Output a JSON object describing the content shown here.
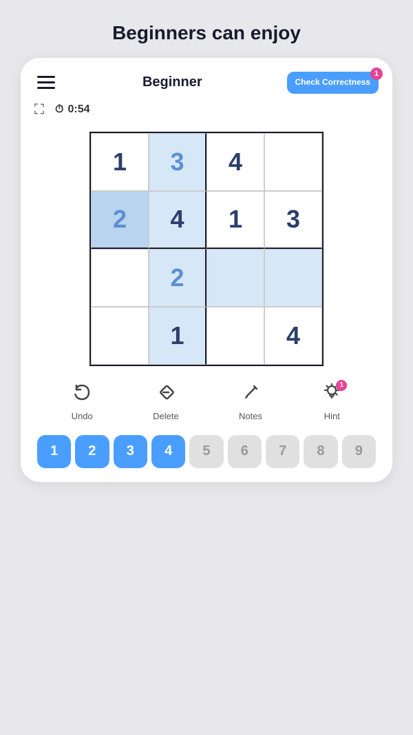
{
  "page": {
    "title": "Beginners can enjoy"
  },
  "header": {
    "title": "Beginner",
    "check_btn": "Check\nCorrectness",
    "badge": "1"
  },
  "timer": {
    "value": "0:54"
  },
  "grid": {
    "cells": [
      {
        "row": 1,
        "col": 1,
        "value": "1",
        "type": "given",
        "bg": "normal"
      },
      {
        "row": 1,
        "col": 2,
        "value": "3",
        "type": "filled",
        "bg": "highlight"
      },
      {
        "row": 1,
        "col": 3,
        "value": "4",
        "type": "given",
        "bg": "normal"
      },
      {
        "row": 1,
        "col": 4,
        "value": "",
        "type": "empty",
        "bg": "normal"
      },
      {
        "row": 2,
        "col": 1,
        "value": "2",
        "type": "filled",
        "bg": "highlight-dark"
      },
      {
        "row": 2,
        "col": 2,
        "value": "4",
        "type": "given",
        "bg": "highlight"
      },
      {
        "row": 2,
        "col": 3,
        "value": "1",
        "type": "given",
        "bg": "normal"
      },
      {
        "row": 2,
        "col": 4,
        "value": "3",
        "type": "given",
        "bg": "normal"
      },
      {
        "row": 3,
        "col": 1,
        "value": "",
        "type": "empty",
        "bg": "normal"
      },
      {
        "row": 3,
        "col": 2,
        "value": "2",
        "type": "filled",
        "bg": "highlight"
      },
      {
        "row": 3,
        "col": 3,
        "value": "",
        "type": "empty",
        "bg": "highlight"
      },
      {
        "row": 3,
        "col": 4,
        "value": "",
        "type": "empty",
        "bg": "highlight"
      },
      {
        "row": 4,
        "col": 1,
        "value": "",
        "type": "empty",
        "bg": "normal"
      },
      {
        "row": 4,
        "col": 2,
        "value": "1",
        "type": "given",
        "bg": "highlight"
      },
      {
        "row": 4,
        "col": 3,
        "value": "",
        "type": "empty",
        "bg": "normal"
      },
      {
        "row": 4,
        "col": 4,
        "value": "4",
        "type": "given",
        "bg": "normal"
      }
    ]
  },
  "toolbar": {
    "items": [
      {
        "id": "undo",
        "label": "Undo",
        "icon": "↩"
      },
      {
        "id": "delete",
        "label": "Delete",
        "icon": "◇"
      },
      {
        "id": "notes",
        "label": "Notes",
        "icon": "✏"
      },
      {
        "id": "hint",
        "label": "Hint",
        "icon": "💡",
        "badge": "1"
      }
    ]
  },
  "numpad": {
    "numbers": [
      {
        "value": "1",
        "active": true
      },
      {
        "value": "2",
        "active": true
      },
      {
        "value": "3",
        "active": true
      },
      {
        "value": "4",
        "active": true
      },
      {
        "value": "5",
        "active": false
      },
      {
        "value": "6",
        "active": false
      },
      {
        "value": "7",
        "active": false
      },
      {
        "value": "8",
        "active": false
      },
      {
        "value": "9",
        "active": false
      }
    ]
  }
}
